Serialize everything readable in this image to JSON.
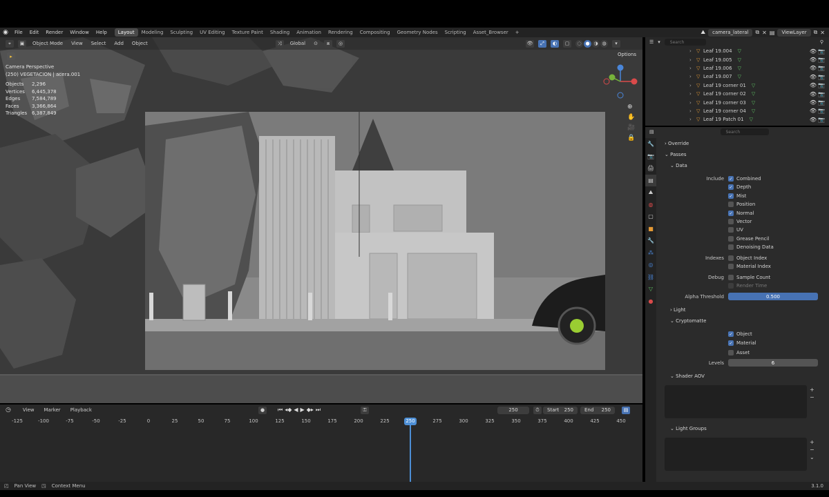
{
  "topbar": {
    "menus": [
      "File",
      "Edit",
      "Render",
      "Window",
      "Help"
    ],
    "workspaces": [
      "Layout",
      "Modeling",
      "Sculpting",
      "UV Editing",
      "Texture Paint",
      "Shading",
      "Animation",
      "Rendering",
      "Compositing",
      "Geometry Nodes",
      "Scripting",
      "Asset_Browser"
    ],
    "active_workspace": "Layout",
    "add_tab_symbol": "+",
    "scene_name": "camera_lateral",
    "view_layer": "ViewLayer"
  },
  "viewport": {
    "mode": "Object Mode",
    "menus": [
      "View",
      "Select",
      "Add",
      "Object"
    ],
    "transform_orientation": "Global",
    "options_label": "Options",
    "camera_label": "Camera Perspective",
    "collection_label": "(250) VEGETACION | acera.001",
    "stats": [
      {
        "key": "Objects",
        "value": "2,296"
      },
      {
        "key": "Vertices",
        "value": "6,445,378"
      },
      {
        "key": "Edges",
        "value": "7,584,789"
      },
      {
        "key": "Faces",
        "value": "3,366,864"
      },
      {
        "key": "Triangles",
        "value": "6,387,849"
      }
    ],
    "gizmo": {
      "x_color": "#d94a4a",
      "y_color": "#77b33a",
      "z_color": "#4a86d9"
    }
  },
  "outliner": {
    "search_placeholder": "Search",
    "items": [
      "Leaf 19.004",
      "Leaf 19.005",
      "Leaf 19.006",
      "Leaf 19.007",
      "Leaf 19 corner 01",
      "Leaf 19 corner 02",
      "Leaf 19 corner 03",
      "Leaf 19 corner 04",
      "Leaf 19 Patch 01"
    ]
  },
  "properties": {
    "search_placeholder": "Search",
    "override_label": "Override",
    "passes_label": "Passes",
    "data_label": "Data",
    "include_label": "Include",
    "include_options": [
      {
        "label": "Combined",
        "checked": true
      },
      {
        "label": "Depth",
        "checked": true
      },
      {
        "label": "Mist",
        "checked": true
      },
      {
        "label": "Position",
        "checked": false
      },
      {
        "label": "Normal",
        "checked": true
      },
      {
        "label": "Vector",
        "checked": false
      },
      {
        "label": "UV",
        "checked": false
      },
      {
        "label": "Grease Pencil",
        "checked": false
      },
      {
        "label": "Denoising Data",
        "checked": false
      }
    ],
    "indexes_label": "Indexes",
    "indexes_options": [
      {
        "label": "Object Index",
        "checked": false
      },
      {
        "label": "Material Index",
        "checked": false
      }
    ],
    "debug_label": "Debug",
    "debug_options": [
      {
        "label": "Sample Count",
        "checked": false
      },
      {
        "label": "Render Time",
        "checked": false
      }
    ],
    "alpha_threshold_label": "Alpha Threshold",
    "alpha_threshold_value": "0.500",
    "alpha_threshold_fraction": 0.5,
    "light_label": "Light",
    "cryptomatte_label": "Cryptomatte",
    "cryptomatte_options": [
      {
        "label": "Object",
        "checked": true
      },
      {
        "label": "Material",
        "checked": true
      },
      {
        "label": "Asset",
        "checked": false
      }
    ],
    "levels_label": "Levels",
    "levels_value": "6",
    "shader_aov_label": "Shader AOV",
    "light_groups_label": "Light Groups"
  },
  "timeline": {
    "menus": [
      "View",
      "Marker",
      "Playback"
    ],
    "current_frame": "250",
    "start_label": "Start",
    "start_value": "250",
    "end_label": "End",
    "end_value": "250",
    "ruler": [
      "-125",
      "-100",
      "-75",
      "-50",
      "-25",
      "0",
      "25",
      "50",
      "75",
      "100",
      "125",
      "150",
      "175",
      "200",
      "225",
      "250",
      "275",
      "300",
      "325",
      "350",
      "375",
      "400",
      "425",
      "450"
    ],
    "playhead_label": "250"
  },
  "statusbar": {
    "left_items": [
      "Pan View",
      "Context Menu"
    ],
    "version": "3.1.0"
  },
  "colors": {
    "accent": "#4772b3",
    "playhead": "#4d8fd6",
    "mesh_icon": "#5ec464",
    "object_icon": "#e59a35"
  }
}
